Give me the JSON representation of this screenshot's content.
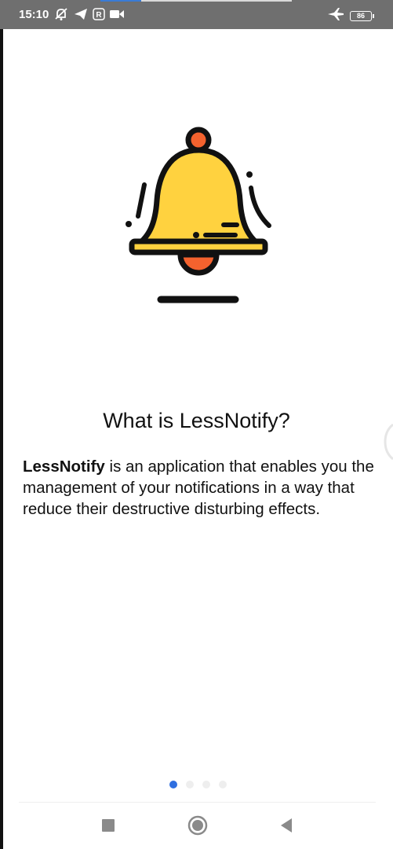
{
  "status_bar": {
    "time": "15:10",
    "icons": [
      "muted-notification-icon",
      "telegram-icon",
      "r-icon",
      "video-camera-icon",
      "airplane-mode-icon"
    ],
    "battery_level": "86"
  },
  "onboarding": {
    "image": "bell-icon",
    "title": "What is LessNotify?",
    "description_bold": "LessNotify",
    "description_rest": " is an application that enables you the management of your notifications in a way that reduce their destructive disturbing effects.",
    "page_count": 4,
    "current_page": 1
  },
  "nav_bar": {
    "buttons": [
      "recents-button",
      "home-button",
      "back-button"
    ]
  },
  "colors": {
    "bell_yellow": "#FFD23F",
    "bell_outline": "#111111",
    "clapper_orange": "#F4622E",
    "active_dot": "#2F6FE0",
    "inactive_dot": "#EEEEEE",
    "status_bar_bg": "#6F6F6F"
  }
}
